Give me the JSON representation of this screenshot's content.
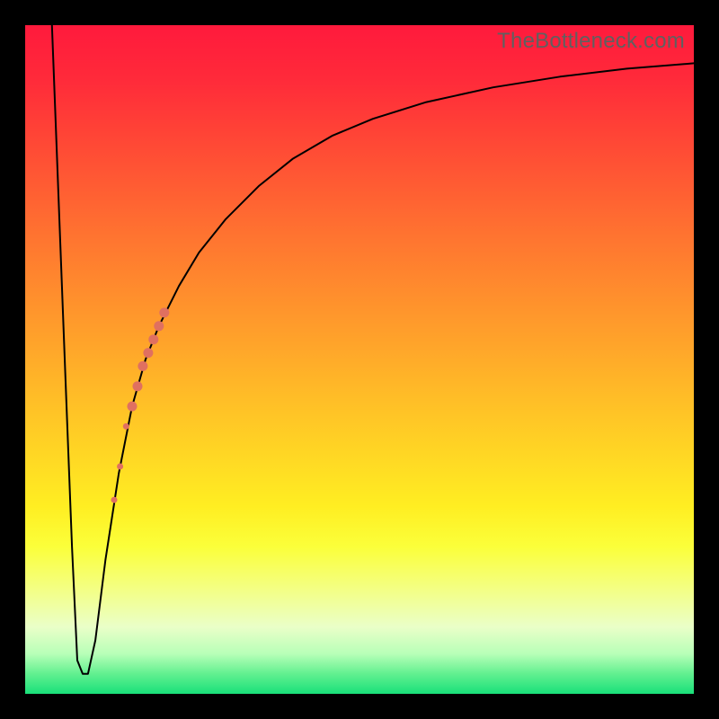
{
  "watermark": "TheBottleneck.com",
  "chart_data": {
    "type": "line",
    "title": "",
    "xlabel": "",
    "ylabel": "",
    "xlim": [
      0,
      100
    ],
    "ylim": [
      0,
      100
    ],
    "grid": false,
    "legend": false,
    "background_gradient": {
      "top_color": "#ff1a3c",
      "mid_color": "#ffd624",
      "bottom_color": "#19e07a"
    },
    "series": [
      {
        "name": "bottleneck-curve",
        "color": "#000000",
        "stroke_width": 2,
        "x": [
          4.0,
          5.0,
          6.0,
          7.0,
          7.8,
          8.6,
          9.4,
          10.5,
          12.0,
          14.0,
          16.0,
          18.0,
          20.0,
          23.0,
          26.0,
          30.0,
          35.0,
          40.0,
          46.0,
          52.0,
          60.0,
          70.0,
          80.0,
          90.0,
          100.0
        ],
        "values": [
          100,
          74,
          48,
          22,
          5,
          3,
          3,
          8,
          20,
          33,
          43,
          50,
          55,
          61,
          66,
          71,
          76,
          80,
          83.5,
          86,
          88.5,
          90.7,
          92.3,
          93.5,
          94.3
        ]
      }
    ],
    "markers": {
      "name": "highlight-band",
      "color": "#e07060",
      "shape": "circle",
      "points": [
        {
          "x": 13.3,
          "y": 29,
          "r": 3.5
        },
        {
          "x": 14.2,
          "y": 34,
          "r": 3.5
        },
        {
          "x": 15.1,
          "y": 40,
          "r": 3.5
        },
        {
          "x": 16.0,
          "y": 43,
          "r": 5.5
        },
        {
          "x": 16.8,
          "y": 46,
          "r": 5.5
        },
        {
          "x": 17.6,
          "y": 49,
          "r": 5.5
        },
        {
          "x": 18.4,
          "y": 51,
          "r": 5.5
        },
        {
          "x": 19.2,
          "y": 53,
          "r": 5.5
        },
        {
          "x": 20.0,
          "y": 55,
          "r": 5.5
        },
        {
          "x": 20.8,
          "y": 57,
          "r": 5.5
        }
      ]
    }
  }
}
